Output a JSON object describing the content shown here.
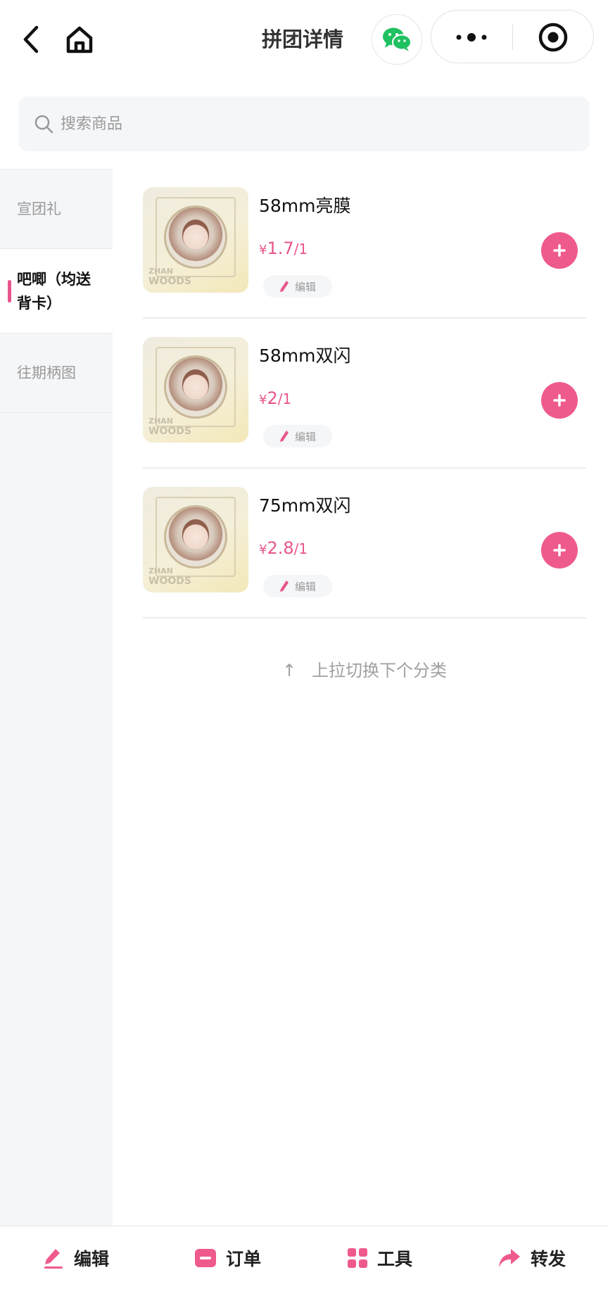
{
  "header": {
    "title": "拼团详情"
  },
  "search": {
    "placeholder": "搜索商品"
  },
  "sidebar": {
    "items": [
      {
        "label": "宣团礼",
        "active": false
      },
      {
        "label": "吧唧（均送背卡）",
        "active": true
      },
      {
        "label": "往期柄图",
        "active": false
      }
    ]
  },
  "products": [
    {
      "name": "58mm亮膜",
      "currency": "¥",
      "price": "1.7",
      "unit": "/1",
      "edit_label": "编辑"
    },
    {
      "name": "58mm双闪",
      "currency": "¥",
      "price": "2",
      "unit": "/1",
      "edit_label": "编辑"
    },
    {
      "name": "75mm双闪",
      "currency": "¥",
      "price": "2.8",
      "unit": "/1",
      "edit_label": "编辑"
    }
  ],
  "thumbnail": {
    "text_line1": "ZHAN",
    "text_line2": "WOODS"
  },
  "pull_hint": {
    "arrow": "↑",
    "text": "上拉切换下个分类"
  },
  "bottom_bar": {
    "edit": "编辑",
    "orders": "订单",
    "tools": "工具",
    "share": "转发"
  },
  "colors": {
    "accent": "#ef5a8c",
    "price": "#e8558d",
    "wechat": "#1fc160"
  }
}
